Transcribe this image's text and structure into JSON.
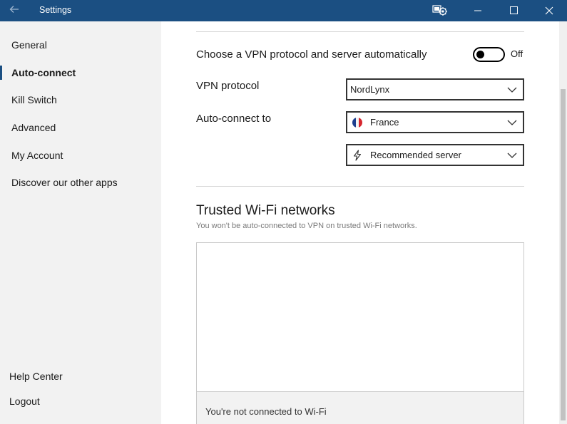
{
  "window": {
    "title": "Settings",
    "back_icon": "arrow-left-icon",
    "controls": [
      "minimize-icon",
      "maximize-icon",
      "close-icon"
    ]
  },
  "sidebar": {
    "items": [
      {
        "label": "General",
        "active": false
      },
      {
        "label": "Auto-connect",
        "active": true
      },
      {
        "label": "Kill Switch",
        "active": false
      },
      {
        "label": "Advanced",
        "active": false
      },
      {
        "label": "My Account",
        "active": false
      },
      {
        "label": "Discover our other apps",
        "active": false
      }
    ],
    "bottom": {
      "help": "Help Center",
      "logout": "Logout"
    }
  },
  "main": {
    "auto_choose": {
      "label": "Choose a VPN protocol and server automatically",
      "toggle_state": "Off"
    },
    "protocol": {
      "label": "VPN protocol",
      "value": "NordLynx"
    },
    "auto_connect": {
      "label": "Auto-connect to",
      "country": "France",
      "server": "Recommended server"
    },
    "trusted": {
      "title": "Trusted Wi-Fi networks",
      "subtitle": "You won't be auto-connected to VPN on trusted Wi-Fi networks.",
      "status": "You're not connected to Wi-Fi"
    }
  },
  "colors": {
    "titlebar": "#1b4f82",
    "sidebar_bg": "#f2f2f2",
    "accent": "#1b4f82"
  }
}
